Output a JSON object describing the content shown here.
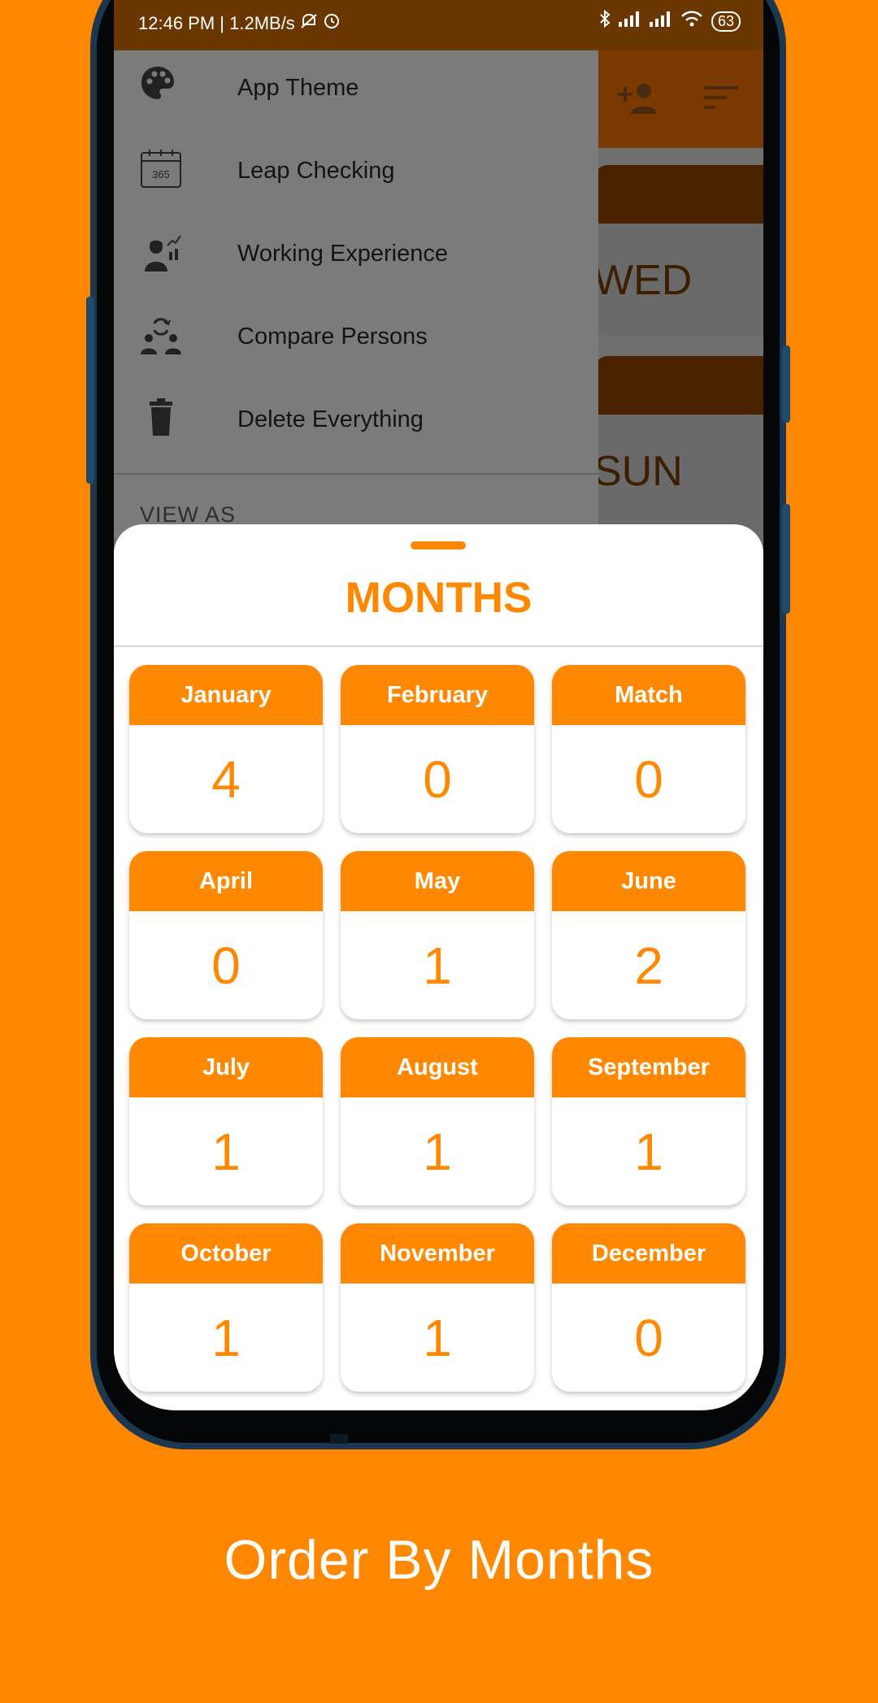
{
  "status_bar": {
    "left_text": "12:46 PM | 1.2MB/s",
    "battery": "63"
  },
  "drawer": {
    "items": [
      {
        "label": "App Theme",
        "icon": "palette-icon"
      },
      {
        "label": "Leap Checking",
        "icon": "calendar-365-icon"
      },
      {
        "label": "Working Experience",
        "icon": "worker-chart-icon"
      },
      {
        "label": "Compare Persons",
        "icon": "compare-persons-icon"
      },
      {
        "label": "Delete Everything",
        "icon": "trash-icon"
      }
    ],
    "section_label": "VIEW AS"
  },
  "background": {
    "day_cards": [
      "WED",
      "SUN"
    ]
  },
  "sheet": {
    "title": "MONTHS",
    "months": [
      {
        "name": "January",
        "count": "4"
      },
      {
        "name": "February",
        "count": "0"
      },
      {
        "name": "Match",
        "count": "0"
      },
      {
        "name": "April",
        "count": "0"
      },
      {
        "name": "May",
        "count": "1"
      },
      {
        "name": "June",
        "count": "2"
      },
      {
        "name": "July",
        "count": "1"
      },
      {
        "name": "August",
        "count": "1"
      },
      {
        "name": "September",
        "count": "1"
      },
      {
        "name": "October",
        "count": "1"
      },
      {
        "name": "November",
        "count": "1"
      },
      {
        "name": "December",
        "count": "0"
      }
    ]
  },
  "caption": "Order By Months",
  "colors": {
    "accent": "#FF8800",
    "background": "#FF8800",
    "card": "#FFFFFF"
  }
}
